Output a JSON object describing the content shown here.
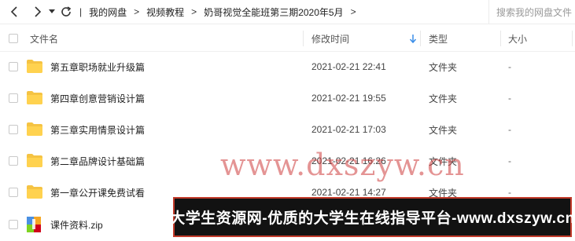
{
  "toolbar": {
    "breadcrumbs": [
      "我的网盘",
      "视频教程",
      "奶哥视觉全能班第三期2020年5月"
    ],
    "search_placeholder": "搜索我的网盘文件"
  },
  "header": {
    "name": "文件名",
    "modified": "修改时间",
    "type": "类型",
    "size": "大小"
  },
  "files": [
    {
      "name": "第五章职场就业升级篇",
      "modified": "2021-02-21 22:41",
      "type": "文件夹",
      "size": "-",
      "icon": "folder-icon"
    },
    {
      "name": "第四章创意营销设计篇",
      "modified": "2021-02-21 19:55",
      "type": "文件夹",
      "size": "-",
      "icon": "folder-icon"
    },
    {
      "name": "第三章实用情景设计篇",
      "modified": "2021-02-21 17:03",
      "type": "文件夹",
      "size": "-",
      "icon": "folder-icon"
    },
    {
      "name": "第二章品牌设计基础篇",
      "modified": "2021-02-21 16:26",
      "type": "文件夹",
      "size": "-",
      "icon": "folder-icon"
    },
    {
      "name": "第一章公开课免费试看",
      "modified": "2021-02-21 14:27",
      "type": "文件夹",
      "size": "-",
      "icon": "folder-icon"
    },
    {
      "name": "课件资料.zip",
      "icon": "zip-archive-icon"
    }
  ],
  "watermark": "www.dxszyw.cn",
  "banner": "大学生资源网-优质的大学生在线指导平台-www.dxszyw.cn",
  "colors": {
    "folder": "#f5c343",
    "watermark": "#cd3c3c",
    "banner_bg": "#121212",
    "banner_border": "#c23a2a",
    "sort_arrow": "#3b8ee8"
  }
}
